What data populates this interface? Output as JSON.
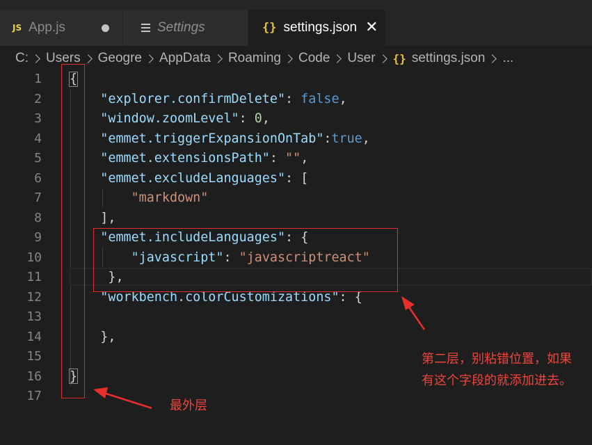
{
  "tabs": [
    {
      "icon": "JS",
      "label": "App.js",
      "modified": true
    },
    {
      "label": "Settings"
    },
    {
      "icon": "{}",
      "label": "settings.json",
      "close": "✕"
    }
  ],
  "breadcrumb": {
    "items": [
      "C:",
      "Users",
      "Geogre",
      "AppData",
      "Roaming",
      "Code",
      "User",
      "settings.json",
      "..."
    ],
    "file_icon": "{}"
  },
  "editor": {
    "line_numbers": [
      "1",
      "2",
      "3",
      "4",
      "5",
      "6",
      "7",
      "8",
      "9",
      "10",
      "11",
      "12",
      "13",
      "14",
      "15",
      "16",
      "17"
    ],
    "code": {
      "l1_open": "{",
      "l2_key": "\"explorer.confirmDelete\"",
      "l2_val": "false",
      "l3_key": "\"window.zoomLevel\"",
      "l3_val": "0",
      "l4_key": "\"emmet.triggerExpansionOnTab\"",
      "l4_val": "true",
      "l5_key": "\"emmet.extensionsPath\"",
      "l5_val": "\"\"",
      "l6_key": "\"emmet.excludeLanguages\"",
      "l6_val": "[",
      "l7_val": "\"markdown\"",
      "l8_close": "],",
      "l9_key": "\"emmet.includeLanguages\"",
      "l9_val": "{",
      "l10_key": "\"javascript\"",
      "l10_val": "\"javascriptreact\"",
      "l11_close": "},",
      "l12_key": "\"workbench.colorCustomizations\"",
      "l12_val": "{",
      "l14_close": "},",
      "l16_close": "}"
    }
  },
  "annotations": {
    "second_layer": "第二层，别粘错位置，如果有这个字段的就添加进去。",
    "outer_layer": "最外层"
  },
  "colors": {
    "annotation": "#f0443c",
    "key": "#9cdcfe",
    "string": "#ce9178",
    "boolean": "#569cd6",
    "number": "#b5cea8"
  }
}
